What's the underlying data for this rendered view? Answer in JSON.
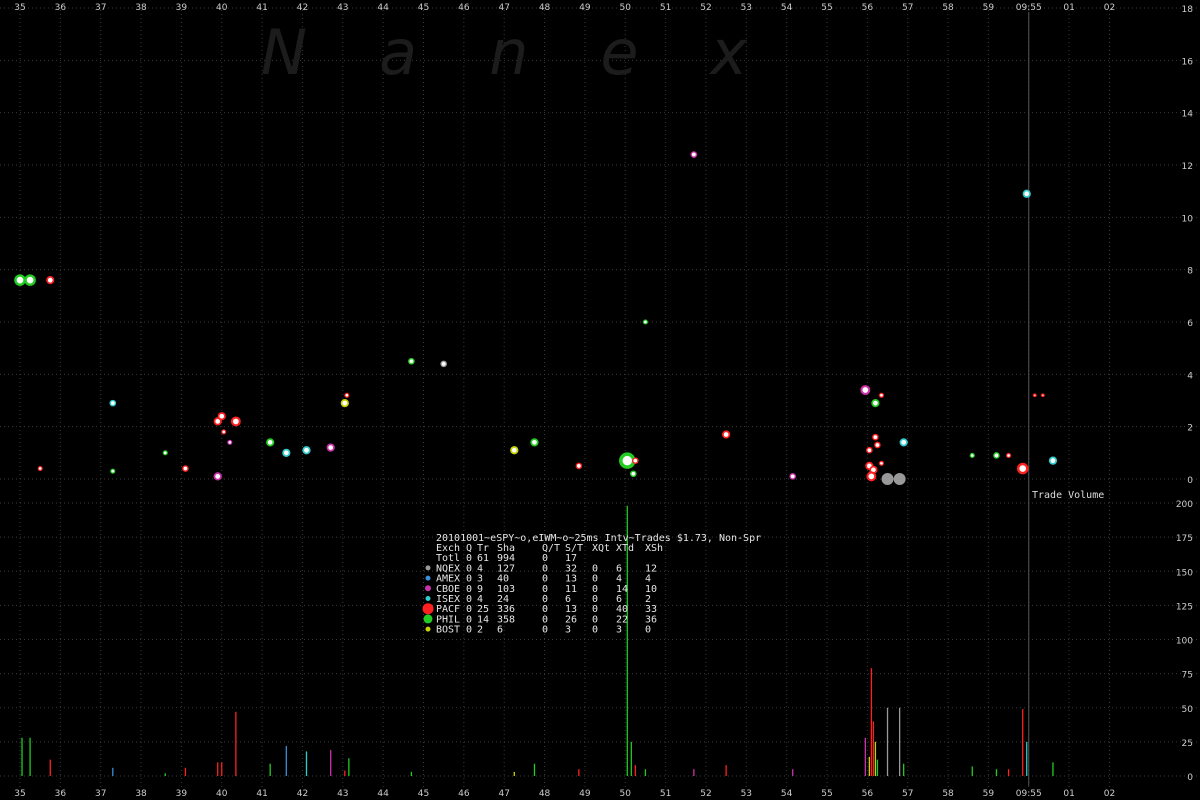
{
  "chart_data": {
    "type": "scatter",
    "watermark": "Nanex",
    "volume_label": "Trade Volume",
    "time_labels": [
      "35",
      "36",
      "37",
      "38",
      "39",
      "40",
      "41",
      "42",
      "43",
      "44",
      "45",
      "46",
      "47",
      "48",
      "49",
      "50",
      "51",
      "52",
      "53",
      "54",
      "55",
      "56",
      "57",
      "58",
      "59",
      "09:55",
      "01",
      "02"
    ],
    "top_axis": {
      "ticks": [
        0,
        2,
        4,
        6,
        8,
        10,
        12,
        14,
        16,
        18
      ],
      "ylim": [
        0,
        18
      ]
    },
    "bottom_axis": {
      "ticks": [
        0,
        25,
        50,
        75,
        100,
        125,
        150,
        175,
        200
      ],
      "ylim": [
        0,
        200
      ]
    },
    "colors": {
      "NQEX": "#999999",
      "AMEX": "#3a8fd8",
      "CBOE": "#cc33aa",
      "ISEX": "#33cccc",
      "PACF": "#ff2020",
      "PHIL": "#22cc22",
      "BOST": "#c8d400"
    },
    "trades": [
      {
        "t": 35.0,
        "p": 7.6,
        "ex": "PHIL",
        "s": 7
      },
      {
        "t": 35.25,
        "p": 7.6,
        "ex": "PHIL",
        "s": 7
      },
      {
        "t": 35.75,
        "p": 7.6,
        "ex": "PACF",
        "s": 5
      },
      {
        "t": 35.5,
        "p": 0.4,
        "ex": "PACF",
        "s": 3
      },
      {
        "t": 37.3,
        "p": 2.9,
        "ex": "ISEX",
        "s": 4
      },
      {
        "t": 37.3,
        "p": 0.3,
        "ex": "PHIL",
        "s": 3
      },
      {
        "t": 38.6,
        "p": 1.0,
        "ex": "PHIL",
        "s": 3
      },
      {
        "t": 39.1,
        "p": 0.4,
        "ex": "PACF",
        "s": 4
      },
      {
        "t": 39.9,
        "p": 0.1,
        "ex": "CBOE",
        "s": 5
      },
      {
        "t": 39.9,
        "p": 2.2,
        "ex": "PACF",
        "s": 5
      },
      {
        "t": 40.0,
        "p": 2.4,
        "ex": "PACF",
        "s": 5
      },
      {
        "t": 40.05,
        "p": 1.8,
        "ex": "PACF",
        "s": 3
      },
      {
        "t": 40.2,
        "p": 1.4,
        "ex": "CBOE",
        "s": 3
      },
      {
        "t": 40.35,
        "p": 2.2,
        "ex": "PACF",
        "s": 6
      },
      {
        "t": 41.2,
        "p": 1.4,
        "ex": "PHIL",
        "s": 5
      },
      {
        "t": 41.6,
        "p": 1.0,
        "ex": "ISEX",
        "s": 5
      },
      {
        "t": 42.1,
        "p": 1.1,
        "ex": "ISEX",
        "s": 5
      },
      {
        "t": 42.7,
        "p": 1.2,
        "ex": "CBOE",
        "s": 5
      },
      {
        "t": 43.1,
        "p": 3.2,
        "ex": "PACF",
        "s": 3
      },
      {
        "t": 43.05,
        "p": 2.9,
        "ex": "BOST",
        "s": 5
      },
      {
        "t": 44.7,
        "p": 4.5,
        "ex": "PHIL",
        "s": 4
      },
      {
        "t": 45.5,
        "p": 4.4,
        "ex": "NQEX",
        "s": 4
      },
      {
        "t": 47.25,
        "p": 1.1,
        "ex": "BOST",
        "s": 5
      },
      {
        "t": 47.75,
        "p": 1.4,
        "ex": "PHIL",
        "s": 5
      },
      {
        "t": 48.85,
        "p": 0.5,
        "ex": "PACF",
        "s": 4
      },
      {
        "t": 50.05,
        "p": 0.7,
        "ex": "PHIL",
        "s": 10
      },
      {
        "t": 50.25,
        "p": 0.7,
        "ex": "PACF",
        "s": 4
      },
      {
        "t": 50.2,
        "p": 0.2,
        "ex": "PHIL",
        "s": 4
      },
      {
        "t": 50.5,
        "p": 6.0,
        "ex": "PHIL",
        "s": 3
      },
      {
        "t": 51.7,
        "p": 12.4,
        "ex": "CBOE",
        "s": 4
      },
      {
        "t": 52.5,
        "p": 1.7,
        "ex": "PACF",
        "s": 5
      },
      {
        "t": 54.15,
        "p": 0.1,
        "ex": "CBOE",
        "s": 4
      },
      {
        "t": 55.95,
        "p": 3.4,
        "ex": "CBOE",
        "s": 6
      },
      {
        "t": 56.2,
        "p": 2.9,
        "ex": "PHIL",
        "s": 5
      },
      {
        "t": 56.35,
        "p": 3.2,
        "ex": "PACF",
        "s": 3
      },
      {
        "t": 56.2,
        "p": 1.6,
        "ex": "PACF",
        "s": 4
      },
      {
        "t": 56.25,
        "p": 1.3,
        "ex": "PACF",
        "s": 4
      },
      {
        "t": 56.05,
        "p": 1.1,
        "ex": "PACF",
        "s": 4
      },
      {
        "t": 56.05,
        "p": 0.5,
        "ex": "PACF",
        "s": 5
      },
      {
        "t": 56.15,
        "p": 0.35,
        "ex": "PACF",
        "s": 5
      },
      {
        "t": 56.35,
        "p": 0.6,
        "ex": "PACF",
        "s": 3
      },
      {
        "t": 56.1,
        "p": 0.1,
        "ex": "PACF",
        "s": 6
      },
      {
        "t": 56.5,
        "p": 0.0,
        "ex": "NQEX",
        "s": 7
      },
      {
        "t": 56.8,
        "p": 0.0,
        "ex": "NQEX",
        "s": 7
      },
      {
        "t": 56.9,
        "p": 1.4,
        "ex": "ISEX",
        "s": 5
      },
      {
        "t": 58.6,
        "p": 0.9,
        "ex": "PHIL",
        "s": 3
      },
      {
        "t": 59.2,
        "p": 0.9,
        "ex": "PHIL",
        "s": 4
      },
      {
        "t": 59.5,
        "p": 0.9,
        "ex": "PACF",
        "s": 3
      },
      {
        "t": 59.85,
        "p": 0.4,
        "ex": "PACF",
        "s": 7
      },
      {
        "t": 59.95,
        "p": 10.9,
        "ex": "ISEX",
        "s": 5
      },
      {
        "t": 60.15,
        "p": 3.2,
        "ex": "PACF",
        "s": 2
      },
      {
        "t": 60.35,
        "p": 3.2,
        "ex": "PACF",
        "s": 2
      },
      {
        "t": 60.6,
        "p": 0.7,
        "ex": "ISEX",
        "s": 5
      }
    ],
    "volumes": [
      {
        "t": 35.05,
        "v": 28,
        "ex": "PHIL"
      },
      {
        "t": 35.25,
        "v": 28,
        "ex": "PHIL"
      },
      {
        "t": 35.75,
        "v": 12,
        "ex": "PACF"
      },
      {
        "t": 37.3,
        "v": 6,
        "ex": "AMEX"
      },
      {
        "t": 38.6,
        "v": 2,
        "ex": "PHIL"
      },
      {
        "t": 39.1,
        "v": 6,
        "ex": "PACF"
      },
      {
        "t": 39.9,
        "v": 10,
        "ex": "PACF"
      },
      {
        "t": 40.0,
        "v": 10,
        "ex": "PACF"
      },
      {
        "t": 40.35,
        "v": 47,
        "ex": "PACF"
      },
      {
        "t": 41.2,
        "v": 9,
        "ex": "PHIL"
      },
      {
        "t": 41.6,
        "v": 22,
        "ex": "AMEX"
      },
      {
        "t": 42.1,
        "v": 18,
        "ex": "ISEX"
      },
      {
        "t": 42.7,
        "v": 19,
        "ex": "CBOE"
      },
      {
        "t": 43.05,
        "v": 4,
        "ex": "PACF"
      },
      {
        "t": 43.15,
        "v": 13,
        "ex": "PHIL"
      },
      {
        "t": 44.7,
        "v": 3,
        "ex": "PHIL"
      },
      {
        "t": 47.25,
        "v": 3,
        "ex": "BOST"
      },
      {
        "t": 47.75,
        "v": 9,
        "ex": "PHIL"
      },
      {
        "t": 48.85,
        "v": 5,
        "ex": "PACF"
      },
      {
        "t": 50.05,
        "v": 198,
        "ex": "PHIL"
      },
      {
        "t": 50.15,
        "v": 25,
        "ex": "PHIL"
      },
      {
        "t": 50.25,
        "v": 8,
        "ex": "PACF"
      },
      {
        "t": 50.5,
        "v": 5,
        "ex": "PHIL"
      },
      {
        "t": 51.7,
        "v": 5,
        "ex": "CBOE"
      },
      {
        "t": 52.5,
        "v": 8,
        "ex": "PACF"
      },
      {
        "t": 54.15,
        "v": 5,
        "ex": "CBOE"
      },
      {
        "t": 55.95,
        "v": 28,
        "ex": "CBOE"
      },
      {
        "t": 56.05,
        "v": 14,
        "ex": "BOST"
      },
      {
        "t": 56.1,
        "v": 79,
        "ex": "PACF"
      },
      {
        "t": 56.15,
        "v": 40,
        "ex": "PACF"
      },
      {
        "t": 56.2,
        "v": 25,
        "ex": "BOST"
      },
      {
        "t": 56.25,
        "v": 12,
        "ex": "PHIL"
      },
      {
        "t": 56.5,
        "v": 50,
        "ex": "NQEX"
      },
      {
        "t": 56.8,
        "v": 50,
        "ex": "NQEX"
      },
      {
        "t": 56.9,
        "v": 9,
        "ex": "PHIL"
      },
      {
        "t": 58.6,
        "v": 7,
        "ex": "PHIL"
      },
      {
        "t": 59.2,
        "v": 5,
        "ex": "PHIL"
      },
      {
        "t": 59.5,
        "v": 5,
        "ex": "PACF"
      },
      {
        "t": 59.85,
        "v": 49,
        "ex": "PACF"
      },
      {
        "t": 59.95,
        "v": 25,
        "ex": "ISEX"
      },
      {
        "t": 60.6,
        "v": 10,
        "ex": "PHIL"
      }
    ]
  },
  "stats": {
    "title": "20101001~eSPY~o,eIWM~o~25ms Intv~Trades $1.73, Non-Spr",
    "header": [
      "Exch",
      "Q",
      "Tr",
      "Sha",
      "Q/T",
      "S/T",
      "XQt",
      "XTd",
      "XSh"
    ],
    "rows": [
      {
        "exch": "Totl",
        "dot": "",
        "cells": [
          "0",
          "61",
          "994",
          "0",
          "17",
          "",
          "",
          ""
        ]
      },
      {
        "exch": "NQEX",
        "dot": "NQEX",
        "cells": [
          "0",
          "4",
          "127",
          "0",
          "32",
          "0",
          "6",
          "12"
        ]
      },
      {
        "exch": "AMEX",
        "dot": "AMEX",
        "cells": [
          "0",
          "3",
          "40",
          "0",
          "13",
          "0",
          "4",
          "4"
        ]
      },
      {
        "exch": "CBOE",
        "dot": "CBOE",
        "cells": [
          "0",
          "9",
          "103",
          "0",
          "11",
          "0",
          "14",
          "10"
        ]
      },
      {
        "exch": "ISEX",
        "dot": "ISEX",
        "cells": [
          "0",
          "4",
          "24",
          "0",
          "6",
          "0",
          "6",
          "2"
        ]
      },
      {
        "exch": "PACF",
        "dot": "PACF",
        "cells": [
          "0",
          "25",
          "336",
          "0",
          "13",
          "0",
          "40",
          "33"
        ]
      },
      {
        "exch": "PHIL",
        "dot": "PHIL",
        "cells": [
          "0",
          "14",
          "358",
          "0",
          "26",
          "0",
          "22",
          "36"
        ]
      },
      {
        "exch": "BOST",
        "dot": "BOST",
        "cells": [
          "0",
          "2",
          "6",
          "0",
          "3",
          "0",
          "3",
          "0"
        ]
      }
    ],
    "dot_sizes": {
      "NQEX": 2.5,
      "AMEX": 2.5,
      "CBOE": 3,
      "ISEX": 2.5,
      "PACF": 5.5,
      "PHIL": 4.5,
      "BOST": 2.5
    }
  }
}
